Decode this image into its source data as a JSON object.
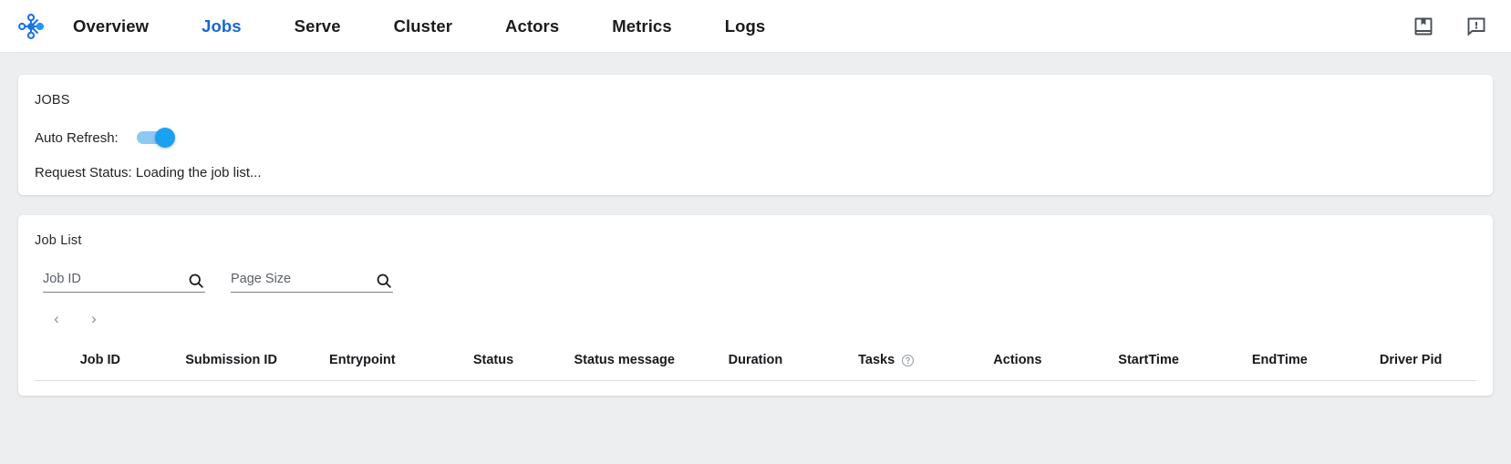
{
  "header": {
    "logo_icon": "ray-logo-icon",
    "nav": [
      {
        "label": "Overview",
        "active": false
      },
      {
        "label": "Jobs",
        "active": true
      },
      {
        "label": "Serve",
        "active": false
      },
      {
        "label": "Cluster",
        "active": false
      },
      {
        "label": "Actors",
        "active": false
      },
      {
        "label": "Metrics",
        "active": false
      },
      {
        "label": "Logs",
        "active": false
      }
    ],
    "actions": [
      {
        "icon": "book-docs-icon"
      },
      {
        "icon": "feedback-icon"
      }
    ],
    "active_color": "#1967d2"
  },
  "jobs_panel": {
    "title": "JOBS",
    "auto_refresh_label": "Auto Refresh:",
    "auto_refresh_on": true,
    "request_status": "Request Status: Loading the job list...",
    "toggle_track_color": "#8ec9f5",
    "toggle_thumb_color": "#1ba1f2"
  },
  "job_list": {
    "title": "Job List",
    "filters": [
      {
        "name": "job-id",
        "placeholder": "Job ID",
        "value": "",
        "icon": "search-icon"
      },
      {
        "name": "page-size",
        "placeholder": "Page Size",
        "value": "",
        "icon": "search-icon"
      }
    ],
    "pagination": {
      "prev_label": "‹",
      "next_label": "›"
    },
    "columns": [
      {
        "label": "Job ID",
        "help": false
      },
      {
        "label": "Submission ID",
        "help": false
      },
      {
        "label": "Entrypoint",
        "help": false
      },
      {
        "label": "Status",
        "help": false
      },
      {
        "label": "Status message",
        "help": false
      },
      {
        "label": "Duration",
        "help": false
      },
      {
        "label": "Tasks",
        "help": true
      },
      {
        "label": "Actions",
        "help": false
      },
      {
        "label": "StartTime",
        "help": false
      },
      {
        "label": "EndTime",
        "help": false
      },
      {
        "label": "Driver Pid",
        "help": false
      }
    ],
    "rows": []
  }
}
